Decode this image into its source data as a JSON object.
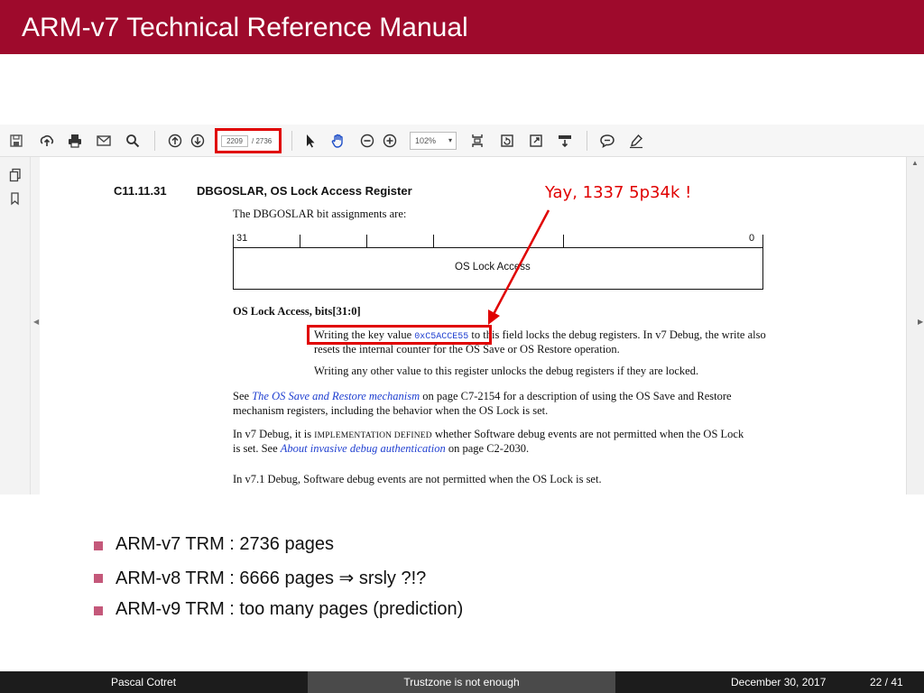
{
  "slide": {
    "title": "ARM-v7 Technical Reference Manual"
  },
  "viewer": {
    "page_current": "2209",
    "page_total": "/ 2736",
    "zoom": "102%",
    "toolbar_icons": [
      "save-icon",
      "upload-icon",
      "print-icon",
      "email-icon",
      "search-icon",
      "page-up-icon",
      "page-down-icon",
      "pointer-icon",
      "hand-icon",
      "zoom-out-icon",
      "zoom-in-icon",
      "fit-page-icon",
      "rotate-icon",
      "fullscreen-icon",
      "download-icon",
      "comment-icon",
      "sign-icon"
    ],
    "sidebar_icons": [
      "pages-icon",
      "bookmark-icon"
    ]
  },
  "document": {
    "section_number": "C11.11.31",
    "section_title": "DBGOSLAR, OS Lock Access Register",
    "intro": "The DBGOSLAR bit assignments are:",
    "bit_high": "31",
    "bit_low": "0",
    "field_label": "OS Lock Access",
    "field_heading": "OS Lock Access, bits[31:0]",
    "p1_a": "Writing the key value ",
    "p1_key": "0xC5ACCE55",
    "p1_b": " to this field locks the debug registers. In v7 Debug, the write also",
    "p1_c": "resets the internal counter for the OS Save or OS Restore operation.",
    "p2": "Writing any other value to this register unlocks the debug registers if they are locked.",
    "see_a": "See ",
    "see_link": "The OS Save and Restore mechanism",
    "see_b": " on page C7-2154 for a description of using the OS Save and Restore",
    "see_c": "mechanism registers, including the behavior when the OS Lock is set.",
    "v7_a": "In v7 Debug, it is ",
    "v7_impl": "IMPLEMENTATION DEFINED",
    "v7_b": " whether Software debug events are not permitted when the OS Lock",
    "v7_c1": "is set. See ",
    "v7_link": "About invasive debug authentication",
    "v7_c2": " on page C2-2030.",
    "v71": "In v7.1 Debug, Software debug events are not permitted when the OS Lock is set."
  },
  "annotation": {
    "text": "Yay, 1337 5p34k !",
    "color": "#e00000"
  },
  "bullets": [
    "ARM-v7 TRM : 2736 pages",
    "ARM-v8 TRM : 6666 pages ⇒ srsly ?!?",
    "ARM-v9 TRM : too many pages (prediction)"
  ],
  "footer": {
    "author": "Pascal Cotret",
    "talk": "Trustzone is not enough",
    "date": "December 30, 2017",
    "page": "22 / 41"
  },
  "colors": {
    "title_bar": "#9e0a2c",
    "bullet": "#c4587a",
    "highlight": "#e00000",
    "link": "#1f3fd0"
  }
}
